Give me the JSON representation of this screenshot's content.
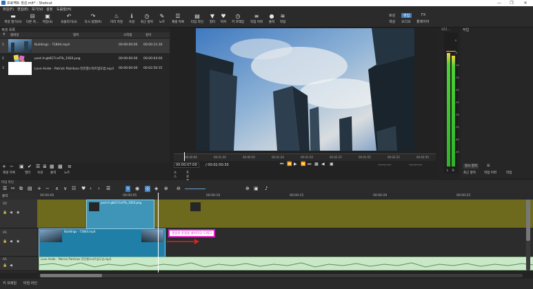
{
  "window": {
    "title": "프로젝트 생성.mlt* - Shotcut",
    "min_symbol": "—",
    "max_symbol": "❐",
    "close_symbol": "✕"
  },
  "menu": [
    "파일(F)",
    "편집(E)",
    "보기(V)",
    "설정",
    "도움말(H)"
  ],
  "toolbar": [
    {
      "label": "파일 열기(O)",
      "icon": "folder-icon",
      "glyph": "▬"
    },
    {
      "label": "다른 저...",
      "icon": "other-icon",
      "glyph": "⊟"
    },
    {
      "label": "저장(S)",
      "icon": "save-icon",
      "glyph": "▣"
    },
    {
      "label": "되돌리기(U)",
      "icon": "undo-icon",
      "glyph": "↶"
    },
    {
      "label": "다시 실행(R)",
      "icon": "redo-icon",
      "glyph": "↷"
    },
    {
      "label": "미리 측정",
      "icon": "peak-meter-icon",
      "glyph": "♨"
    },
    {
      "label": "속성",
      "icon": "properties-icon",
      "glyph": "ℹ"
    },
    {
      "label": "최근 항목",
      "icon": "recent-icon",
      "glyph": "◷"
    },
    {
      "label": "노트",
      "icon": "notes-icon",
      "glyph": "✎"
    },
    {
      "label": "재생 목록",
      "icon": "playlist-icon",
      "glyph": "☰"
    },
    {
      "label": "타임 라인",
      "icon": "timeline-icon",
      "glyph": "▤"
    },
    {
      "label": "필터",
      "icon": "filter-icon",
      "glyph": "▼"
    },
    {
      "label": "마커",
      "icon": "marker-icon",
      "glyph": "♥"
    },
    {
      "label": "키 프레임",
      "icon": "keyframes-icon",
      "glyph": "◷"
    },
    {
      "label": "작업 이력",
      "icon": "history-icon",
      "glyph": "≡"
    },
    {
      "label": "출력",
      "icon": "export-icon",
      "glyph": "●"
    },
    {
      "label": "작업",
      "icon": "jobs-icon",
      "glyph": "≋"
    }
  ],
  "layout_tabs": {
    "top": [
      "로깅",
      "편집",
      "FX"
    ],
    "bottom": [
      "색상",
      "오디오",
      "플레이어"
    ],
    "active": "편집"
  },
  "playlist": {
    "panel_title": "재생 목록",
    "columns": [
      "#",
      "썸네일",
      "항목",
      "시작점",
      "길이"
    ],
    "rows": [
      {
        "num": "1",
        "name": "Buildings - 71844.mp4",
        "in": "00:00:00:00",
        "duration": "00:00:11:30"
      },
      {
        "num": "2",
        "name": "post-it-gb617cef7b_1920.png",
        "in": "00:00:00:00",
        "duration": "00:00:04:00"
      },
      {
        "num": "3",
        "name": "Love Aside - Patrick Patrikios-전진행스타트업도업.mp3",
        "in": "00:00:00:00",
        "duration": "00:02:50:35"
      }
    ],
    "bottom_tabs": [
      "재생 목록",
      "필터",
      "속성",
      "출력",
      "노트"
    ]
  },
  "viewer": {
    "timecode": "00:00:07:09",
    "total": "/ 00:02:50:35",
    "ruler_ticks": [
      "00:00:00",
      "00:01:30",
      "00:00:50",
      "00:01:20",
      "00:01:50",
      "00:02:25",
      "00:01:55",
      "00:02:25",
      "00:02:50"
    ],
    "tabs": [
      "소스",
      "프로젝트"
    ],
    "in_point": "--:--:--:--",
    "out_point": "--:--:--:--"
  },
  "audio_meter": {
    "title": "오디...",
    "labels": [
      "0",
      "-5",
      "-10",
      "-15",
      "-20",
      "-25",
      "-30",
      "-35",
      "-40",
      "-45",
      "-50"
    ],
    "channels": [
      "L",
      "R"
    ],
    "level_left": 0.84,
    "level_right": 0.82
  },
  "right_panel": {
    "title": "작업",
    "pause_button": "일시 정지",
    "tabs": [
      "최근 항목",
      "작업 이력",
      "작업"
    ]
  },
  "timeline": {
    "title": "타임 라인",
    "output_label": "출력",
    "ruler": [
      "00:00:00",
      "00:00:05",
      "00:00:10",
      "00:00:15",
      "00:00:20",
      "00:00:25"
    ],
    "tracks": [
      {
        "name": "V2",
        "clip": "post-it-gb617cef7b_1920.png"
      },
      {
        "name": "V1",
        "clip": "Buildings - 71844.mp4"
      },
      {
        "name": "A1",
        "clip": "Love Aside - Patrick Patrikios-전진행스타트업도업.mp3"
      }
    ],
    "annotation": "영상의 끝점을 클릭하고 드래그",
    "colors": {
      "v2": "#6d6a1e",
      "v1": "#1f7fa6",
      "a1": "#c9e8c7",
      "annotation": "#e020c8",
      "arrow": "#e02020"
    }
  },
  "bottom_tabs": [
    "키 프레임",
    "타임 라인"
  ]
}
